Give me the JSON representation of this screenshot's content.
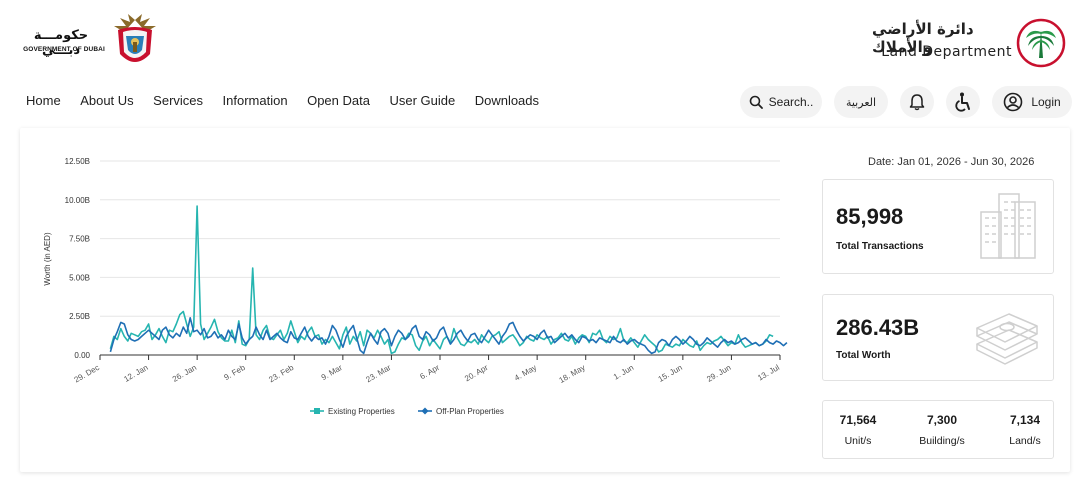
{
  "header": {
    "gov_logo": {
      "text_ar": "حكومـــة دبـــي",
      "text_en": "GOVERNMENT OF DUBAI"
    },
    "dld_logo": {
      "text_ar": "دائرة الأراضي والأملاك",
      "text_en": "Land Department"
    }
  },
  "nav": {
    "items": [
      "Home",
      "About Us",
      "Services",
      "Information",
      "Open Data",
      "User Guide",
      "Downloads"
    ]
  },
  "toolbar": {
    "search_label": "Search..",
    "language_label": "العربية",
    "login_label": "Login",
    "icons": [
      "search-icon",
      "bell-icon",
      "accessibility-icon",
      "user-icon"
    ]
  },
  "stats": {
    "date_range": "Date: Jan 01, 2026 - Jun 30, 2026",
    "total_transactions": {
      "value": "85,998",
      "label": "Total Transactions"
    },
    "total_worth": {
      "value": "286.43B",
      "label": "Total Worth"
    },
    "breakdown": [
      {
        "value": "71,564",
        "label": "Unit/s"
      },
      {
        "value": "7,300",
        "label": "Building/s"
      },
      {
        "value": "7,134",
        "label": "Land/s"
      }
    ]
  },
  "colors": {
    "existing": "#26b5b0",
    "offplan": "#1f6fb5",
    "grid": "#e6e6e6"
  },
  "chart_data": {
    "type": "line",
    "title": "",
    "xlabel": "",
    "ylabel": "Worth (in AED)",
    "ylim": [
      0,
      12.5
    ],
    "y_unit": "B",
    "y_ticks": [
      "0.00",
      "2.50B",
      "5.00B",
      "7.50B",
      "10.00B",
      "12.50B"
    ],
    "x_ticks": [
      "29. Dec",
      "12. Jan",
      "26. Jan",
      "9. Feb",
      "23. Feb",
      "9. Mar",
      "23. Mar",
      "6. Apr",
      "20. Apr",
      "4. May",
      "18. May",
      "1. Jun",
      "15. Jun",
      "29. Jun",
      "13. Jul"
    ],
    "x_start": "2025-12-29",
    "x_end": "2026-07-13",
    "legend": "bottom-center",
    "grid": true,
    "series": [
      {
        "name": "Existing Properties",
        "start": "2026-01-01",
        "values": [
          0.4,
          1.2,
          1.0,
          1.7,
          1.2,
          0.9,
          1.4,
          1.3,
          1.2,
          1.5,
          1.6,
          2.0,
          1.0,
          1.3,
          1.7,
          1.2,
          0.8,
          1.6,
          1.5,
          2.0,
          2.6,
          2.8,
          2.0,
          1.2,
          1.8,
          9.6,
          2.0,
          1.0,
          1.4,
          1.8,
          2.3,
          1.5,
          1.1,
          0.9,
          0.9,
          1.6,
          0.8,
          2.2,
          0.7,
          0.6,
          1.0,
          5.6,
          1.3,
          1.0,
          1.6,
          1.9,
          1.1,
          1.0,
          1.3,
          1.6,
          1.0,
          1.4,
          2.2,
          1.5,
          0.8,
          1.2,
          1.0,
          1.5,
          1.8,
          1.2,
          1.3,
          0.7,
          1.0,
          0.8,
          1.2,
          0.8,
          0.4,
          1.3,
          1.8,
          0.7,
          1.2,
          0.9,
          1.5,
          0.6,
          1.6,
          1.4,
          1.1,
          1.6,
          1.2,
          0.7,
          1.0,
          0.1,
          0.2,
          0.7,
          1.1,
          1.0,
          1.4,
          1.3,
          0.6,
          0.3,
          0.9,
          1.2,
          0.6,
          1.0,
          0.7,
          0.4,
          1.0,
          1.2,
          0.8,
          1.7,
          1.1,
          0.7,
          0.6,
          0.9,
          0.8,
          1.0,
          0.7,
          1.3,
          1.0,
          0.8,
          1.2,
          1.3,
          1.5,
          0.8,
          1.0,
          1.2,
          1.3,
          1.0,
          0.6,
          0.8,
          1.2,
          1.0,
          0.9,
          1.3,
          1.1,
          1.0,
          1.2,
          0.7,
          1.0,
          1.1,
          1.4,
          1.0,
          0.9,
          1.2,
          0.7,
          1.1,
          1.3,
          1.2,
          0.8,
          1.4,
          1.3,
          1.6,
          1.0,
          0.8,
          1.2,
          1.0,
          1.1,
          1.7,
          0.9,
          0.8,
          1.1,
          0.8,
          0.5,
          0.9,
          1.3,
          1.0,
          0.8,
          0.6,
          0.2,
          0.3,
          0.7,
          0.6,
          0.5,
          0.7,
          0.6,
          1.0,
          0.8,
          0.6,
          0.5,
          0.9,
          0.3,
          0.6,
          0.8,
          0.7,
          0.9,
          1.0,
          1.2,
          0.9,
          0.6,
          0.8,
          0.7,
          1.3,
          0.8,
          0.5,
          0.6,
          0.7,
          0.8,
          0.6,
          0.7,
          0.9,
          1.3,
          1.2
        ],
        "color": "#26b5b0"
      },
      {
        "name": "Off-Plan Properties",
        "start": "2026-01-01",
        "values": [
          0.2,
          1.0,
          1.5,
          2.1,
          2.0,
          1.3,
          1.0,
          0.9,
          1.0,
          1.2,
          1.4,
          1.6,
          1.4,
          1.2,
          1.0,
          1.6,
          1.8,
          1.3,
          1.1,
          1.4,
          1.2,
          1.8,
          1.4,
          2.4,
          1.5,
          1.6,
          1.3,
          1.7,
          1.1,
          1.2,
          1.5,
          1.1,
          1.3,
          1.0,
          1.6,
          1.2,
          1.0,
          2.0,
          1.1,
          0.7,
          1.0,
          1.2,
          1.8,
          1.3,
          1.0,
          1.6,
          1.0,
          1.2,
          1.4,
          1.1,
          0.9,
          0.8,
          1.5,
          1.1,
          1.0,
          1.4,
          1.8,
          1.2,
          0.9,
          1.2,
          1.0,
          1.1,
          0.7,
          1.2,
          1.9,
          1.6,
          1.0,
          0.5,
          1.2,
          1.6,
          1.9,
          1.1,
          0.3,
          0.1,
          0.8,
          1.4,
          1.0,
          0.7,
          1.5,
          1.7,
          1.4,
          0.6,
          1.2,
          1.6,
          1.4,
          1.0,
          1.2,
          1.7,
          1.9,
          1.2,
          1.0,
          1.5,
          1.3,
          0.9,
          1.1,
          1.6,
          1.8,
          1.2,
          0.7,
          1.0,
          1.4,
          1.6,
          1.2,
          0.9,
          1.3,
          1.4,
          1.0,
          0.8,
          1.2,
          1.6,
          1.3,
          1.0,
          0.7,
          1.2,
          1.5,
          2.0,
          2.1,
          1.6,
          1.2,
          0.9,
          1.1,
          1.3,
          1.2,
          1.0,
          1.4,
          1.6,
          1.1,
          1.2,
          0.8,
          1.0,
          1.2,
          1.4,
          1.1,
          1.3,
          1.0,
          0.8,
          1.2,
          1.1,
          0.9,
          1.0,
          0.8,
          1.1,
          1.0,
          0.9,
          0.8,
          1.2,
          0.9,
          0.8,
          1.0,
          0.7,
          0.9,
          1.0,
          0.8,
          0.7,
          0.6,
          0.3,
          0.1,
          0.2,
          0.8,
          1.0,
          0.9,
          0.6,
          1.0,
          1.2,
          1.0,
          0.7,
          0.9,
          1.2,
          1.0,
          0.7,
          0.6,
          0.8,
          1.1,
          0.9,
          0.7,
          0.5,
          0.8,
          1.0,
          0.8,
          0.9,
          0.7,
          0.8,
          1.0,
          1.1,
          0.9,
          0.7,
          0.8,
          0.6,
          0.7,
          1.0,
          0.8,
          0.7,
          0.9,
          0.8,
          0.6,
          0.8
        ]
      }
    ]
  }
}
